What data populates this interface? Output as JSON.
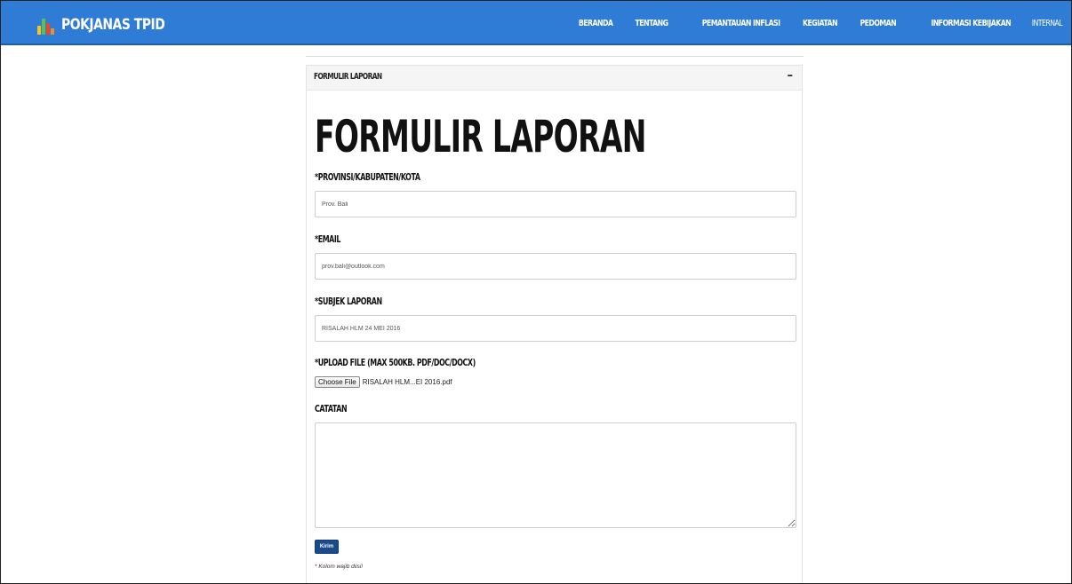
{
  "navbar": {
    "brand": "POKJANAS TPID",
    "bg_color": "#2e7cd6",
    "menu": [
      {
        "label": "BERANDA"
      },
      {
        "label": "TENTANG"
      },
      {
        "label": "PEMANTAUAN INFLASI"
      },
      {
        "label": "KEGIATAN"
      },
      {
        "label": "PEDOMAN"
      },
      {
        "label": "INFORMASI KEBIJAKAN"
      },
      {
        "label": "INTERNAL"
      }
    ]
  },
  "panel": {
    "header_title": "FORMULIR LAPORAN",
    "collapse_symbol": "–",
    "form_title": "FORMULIR LAPORAN",
    "fields": {
      "provinsi": {
        "label": "*PROVINSI/KABUPATEN/KOTA",
        "value": "Prov. Bali"
      },
      "email": {
        "label": "*EMAIL",
        "value": "prov.bali@outlook.com"
      },
      "subjek": {
        "label": "*SUBJEK LAPORAN",
        "value": "RISALAH HLM 24 MEI 2016"
      },
      "upload": {
        "label": "*UPLOAD FILE (MAX 500KB. PDF/DOC/DOCX)",
        "button": "Choose File",
        "file_name": "RISALAH HLM...EI 2016.pdf"
      },
      "catatan": {
        "label": "CATATAN",
        "value": ""
      }
    },
    "submit_label": "Kirim",
    "submit_color": "#1a4a8e",
    "required_note": "* Kolom wajib diisi!"
  }
}
